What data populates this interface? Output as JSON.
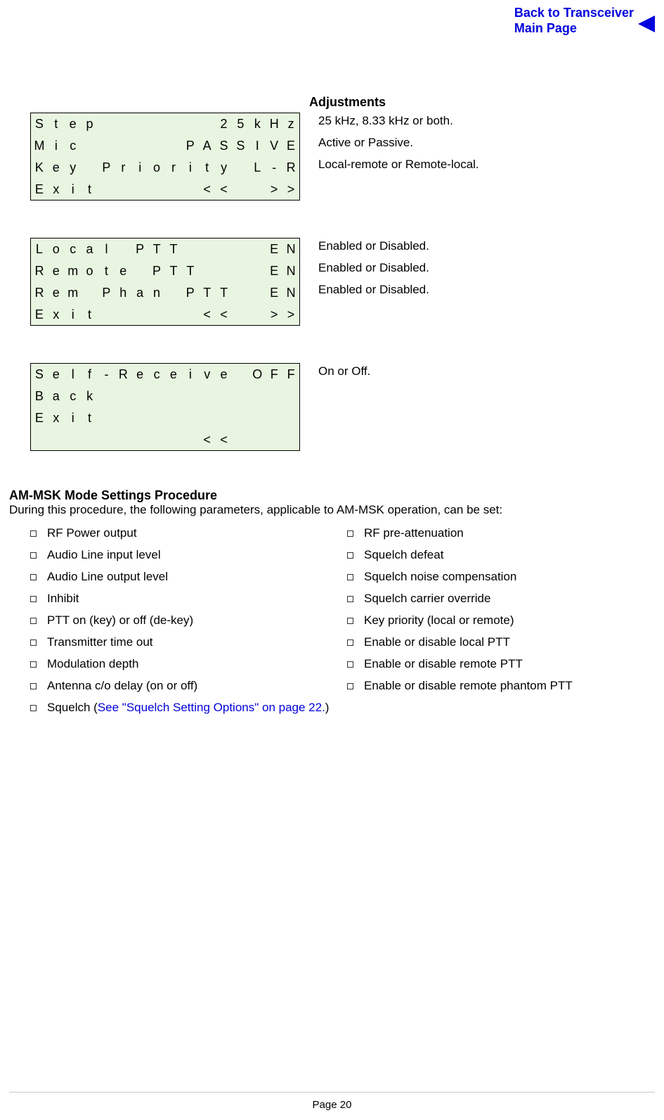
{
  "top_link": {
    "line1": "Back to Transceiver",
    "line2": "Main Page"
  },
  "adjustments_heading": "Adjustments",
  "screen1": {
    "rows": [
      [
        "S",
        "t",
        "e",
        "p",
        "",
        "",
        "",
        "",
        "",
        "",
        "",
        "2",
        "5",
        "k",
        "H",
        "z"
      ],
      [
        "M",
        "i",
        "c",
        "",
        "",
        "",
        "",
        "",
        "",
        "P",
        "A",
        "S",
        "S",
        "I",
        "V",
        "E"
      ],
      [
        "K",
        "e",
        "y",
        "",
        "P",
        "r",
        "i",
        "o",
        "r",
        "i",
        "t",
        "y",
        "",
        "L",
        "-",
        "R"
      ],
      [
        "E",
        "x",
        "i",
        "t",
        "",
        "",
        "",
        "",
        "",
        "",
        "<",
        "<",
        "",
        "",
        ">",
        ">"
      ]
    ],
    "desc": [
      "25 kHz, 8.33 kHz or both.",
      "Active or Passive.",
      "Local-remote or Remote-local."
    ]
  },
  "screen2": {
    "rows": [
      [
        "L",
        "o",
        "c",
        "a",
        "l",
        "",
        "P",
        "T",
        "T",
        "",
        "",
        "",
        "",
        "",
        "E",
        "N"
      ],
      [
        "R",
        "e",
        "m",
        "o",
        "t",
        "e",
        "",
        "P",
        "T",
        "T",
        "",
        "",
        "",
        "",
        "E",
        "N"
      ],
      [
        "R",
        "e",
        "m",
        "",
        "P",
        "h",
        "a",
        "n",
        "",
        "P",
        "T",
        "T",
        "",
        "",
        "E",
        "N"
      ],
      [
        "E",
        "x",
        "i",
        "t",
        "",
        "",
        "",
        "",
        "",
        "",
        "<",
        "<",
        "",
        "",
        ">",
        ">"
      ]
    ],
    "desc": [
      "Enabled or Disabled.",
      "Enabled or Disabled.",
      "Enabled or Disabled."
    ]
  },
  "screen3": {
    "rows": [
      [
        "S",
        "e",
        "l",
        "f",
        "-",
        "R",
        "e",
        "c",
        "e",
        "i",
        "v",
        "e",
        "",
        "O",
        "F",
        "F"
      ],
      [
        "B",
        "a",
        "c",
        "k",
        "",
        "",
        "",
        "",
        "",
        "",
        "",
        "",
        "",
        "",
        "",
        ""
      ],
      [
        "E",
        "x",
        "i",
        "t",
        "",
        "",
        "",
        "",
        "",
        "",
        "",
        "",
        "",
        "",
        "",
        ""
      ],
      [
        "",
        "",
        "",
        "",
        "",
        "",
        "",
        "",
        "",
        "",
        "<",
        "<",
        "",
        "",
        "",
        ""
      ]
    ],
    "desc": [
      "On or Off."
    ]
  },
  "section_heading": "AM-MSK Mode Settings Procedure",
  "section_sub": "During this procedure, the following parameters, applicable to AM-MSK operation, can be set:",
  "list_left": [
    {
      "text": "RF Power output"
    },
    {
      "text": "Audio Line input level"
    },
    {
      "text": "Audio Line output level"
    },
    {
      "text": "Inhibit"
    },
    {
      "text": "PTT on (key) or off (de-key)"
    },
    {
      "text": "Transmitter time out"
    },
    {
      "text": "Modulation depth"
    },
    {
      "text": "Antenna c/o delay (on or off)"
    },
    {
      "text_pre": "Squelch (",
      "link": "See \"Squelch Setting Options\" on page 22.",
      "text_post": ")"
    }
  ],
  "list_right": [
    {
      "text": "RF pre-attenuation"
    },
    {
      "text": "Squelch defeat"
    },
    {
      "text": "Squelch noise compensation"
    },
    {
      "text": "Squelch carrier override"
    },
    {
      "text": "Key priority (local or remote)"
    },
    {
      "text": "Enable or disable local PTT"
    },
    {
      "text": "Enable or disable remote PTT"
    },
    {
      "text": "Enable or disable remote phantom PTT"
    }
  ],
  "footer": "Page 20"
}
